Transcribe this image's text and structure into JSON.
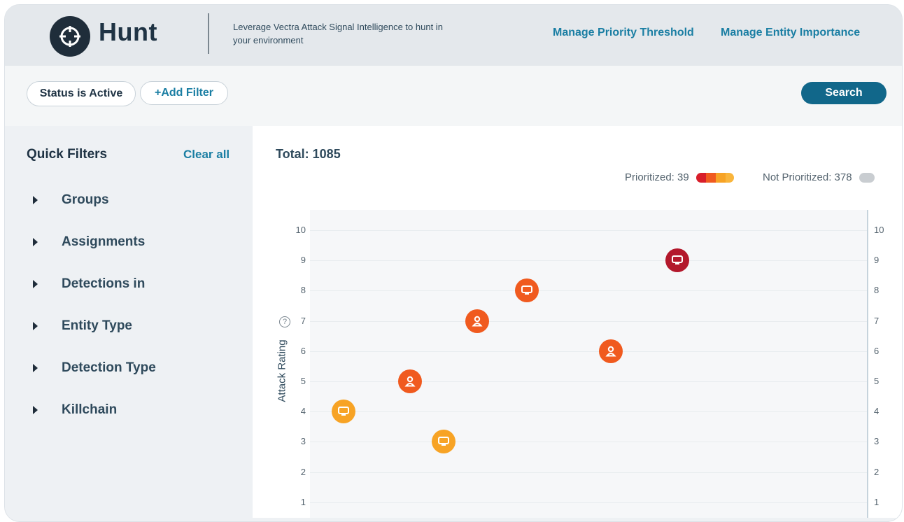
{
  "header": {
    "app_title": "Hunt",
    "tagline": "Leverage Vectra Attack Signal Intelligence to hunt in your environment",
    "links": [
      "Manage Priority Threshold",
      "Manage Entity Importance"
    ]
  },
  "filterbar": {
    "status_chip": "Status is Active",
    "add_filter": "+Add Filter",
    "search_label": "Search"
  },
  "sidebar": {
    "title": "Quick Filters",
    "clear_all": "Clear all",
    "items": [
      "Groups",
      "Assignments",
      "Detections in",
      "Entity Type",
      "Detection Type",
      "Killchain"
    ]
  },
  "main": {
    "total": "Total: 1085",
    "legend_prioritized": "Prioritized: 39",
    "legend_not_prioritized": "Not Prioritized: 378"
  },
  "colors": {
    "accent": "#1a7ea3",
    "search_button": "#11678a",
    "critical": "#b3182c",
    "high": "#f05a1f",
    "medium": "#f7a325"
  },
  "chart_data": {
    "type": "scatter",
    "ylabel": "Attack Rating",
    "ylim": [
      1,
      10
    ],
    "y_ticks": [
      10,
      9,
      8,
      7,
      6,
      5,
      4,
      3,
      2,
      1
    ],
    "grid": true,
    "legend_placement": "top-right",
    "points": [
      {
        "x": 0.06,
        "y": 4,
        "entity": "host",
        "color": "#f7a325"
      },
      {
        "x": 0.24,
        "y": 3,
        "entity": "host",
        "color": "#f7a325"
      },
      {
        "x": 0.18,
        "y": 5,
        "entity": "account",
        "color": "#f05a1f"
      },
      {
        "x": 0.3,
        "y": 7,
        "entity": "account",
        "color": "#f05a1f"
      },
      {
        "x": 0.39,
        "y": 8,
        "entity": "host",
        "color": "#f05a1f"
      },
      {
        "x": 0.54,
        "y": 6,
        "entity": "account",
        "color": "#f05a1f"
      },
      {
        "x": 0.66,
        "y": 9,
        "entity": "host",
        "color": "#b3182c"
      }
    ]
  }
}
